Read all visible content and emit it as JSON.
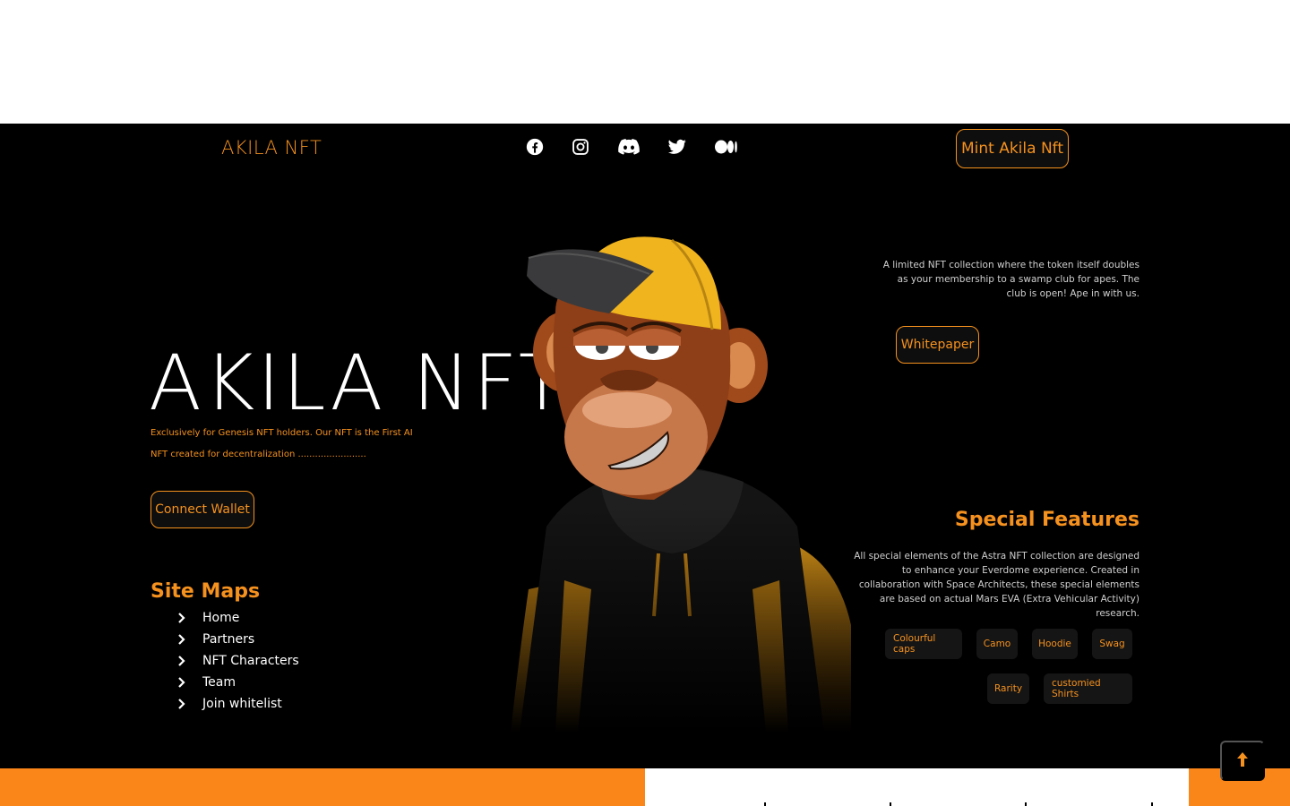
{
  "nav": {
    "brand": "AKILA NFT",
    "social_icons": [
      "facebook-icon",
      "instagram-icon",
      "discord-icon",
      "twitter-icon",
      "medium-icon"
    ],
    "mint_label": "Mint Akila Nft"
  },
  "hero": {
    "title": "AKILA NFT",
    "subtitle": "Exclusively for Genesis NFT holders. Our NFT is the First AI NFT created for decentralization ........................",
    "connect_label": "Connect Wallet"
  },
  "sitemap": {
    "title": "Site Maps",
    "items": [
      "Home",
      "Partners",
      "NFT Characters",
      "Team",
      "Join whitelist"
    ]
  },
  "about": {
    "description": "A limited NFT collection where the token itself doubles as your membership to a swamp club for apes. The club is open! Ape in with us.",
    "whitepaper_label": "Whitepaper"
  },
  "features": {
    "title": "Special Features",
    "description": "All special elements of the Astra NFT collection are designed to enhance your Everdome experience. Created in collaboration with Space Architects, these special elements are based on actual Mars EVA (Extra Vehicular Activity) research.",
    "tags": [
      "Colourful caps",
      "Camo",
      "Hoodie",
      "Swag",
      "Rarity",
      "customied Shirts"
    ]
  },
  "colors": {
    "accent": "#f5911e",
    "background": "#000000",
    "bottom_bar": "#fa8518"
  },
  "scroll_top_icon": "arrow-up-icon"
}
